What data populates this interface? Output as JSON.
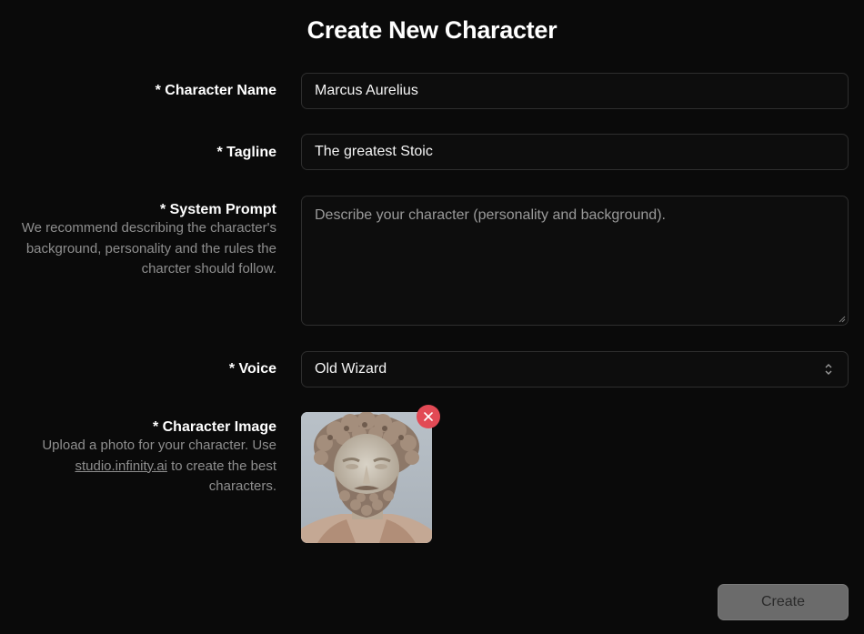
{
  "page": {
    "title": "Create New Character"
  },
  "form": {
    "name": {
      "label": "* Character Name",
      "value": "Marcus Aurelius"
    },
    "tagline": {
      "label": "* Tagline",
      "value": "The greatest Stoic"
    },
    "system_prompt": {
      "label": "* System Prompt",
      "help": "We recommend describing the character's background, personality and the rules the charcter should follow.",
      "placeholder": "Describe your character (personality and background).",
      "value": ""
    },
    "voice": {
      "label": "* Voice",
      "selected": "Old Wizard"
    },
    "image": {
      "label": "* Character Image",
      "help_prefix": "Upload a photo for your character. Use ",
      "help_link": "studio.infinity.ai",
      "help_suffix": " to create the best characters.",
      "remove_icon": "close-icon",
      "remove_color": "#e24a55"
    },
    "submit": {
      "label": "Create"
    }
  },
  "colors": {
    "background": "#0a0a0a",
    "border": "#2e2e2e",
    "muted_text": "#8e8e8e",
    "button_disabled": "#6b6b6b"
  }
}
